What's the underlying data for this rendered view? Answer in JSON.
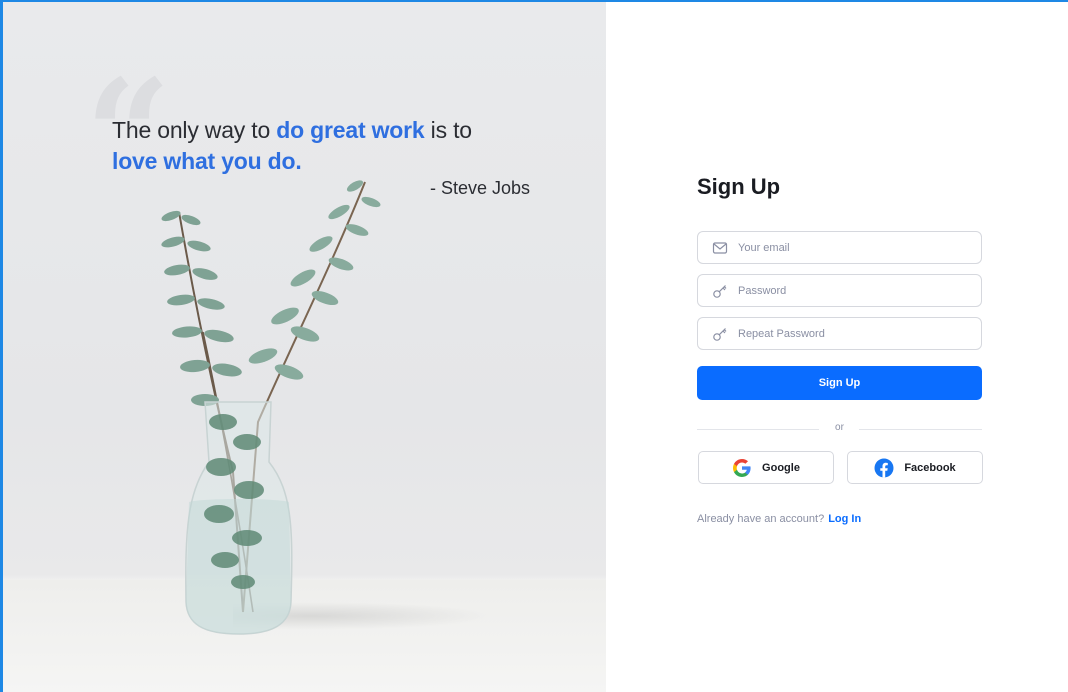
{
  "hero": {
    "quote_part1": "The only way to ",
    "quote_highlight1": "do great work",
    "quote_part2": " is to ",
    "quote_highlight2": "love what you do.",
    "author": "- Steve Jobs",
    "quote_mark": "“"
  },
  "form": {
    "title": "Sign Up",
    "email_placeholder": "Your email",
    "password_placeholder": "Password",
    "repeat_password_placeholder": "Repeat Password",
    "submit_label": "Sign Up",
    "divider_text": "or",
    "google_label": "Google",
    "facebook_label": "Facebook",
    "login_prompt": "Already have an account?",
    "login_link": "Log In"
  },
  "colors": {
    "primary": "#0a6cff",
    "highlight": "#2f6fe0",
    "frame_accent": "#1e88e5"
  },
  "icons": {
    "email": "mail-icon",
    "password": "key-icon",
    "repeat_password": "key-icon",
    "google": "google-icon",
    "facebook": "facebook-icon"
  }
}
